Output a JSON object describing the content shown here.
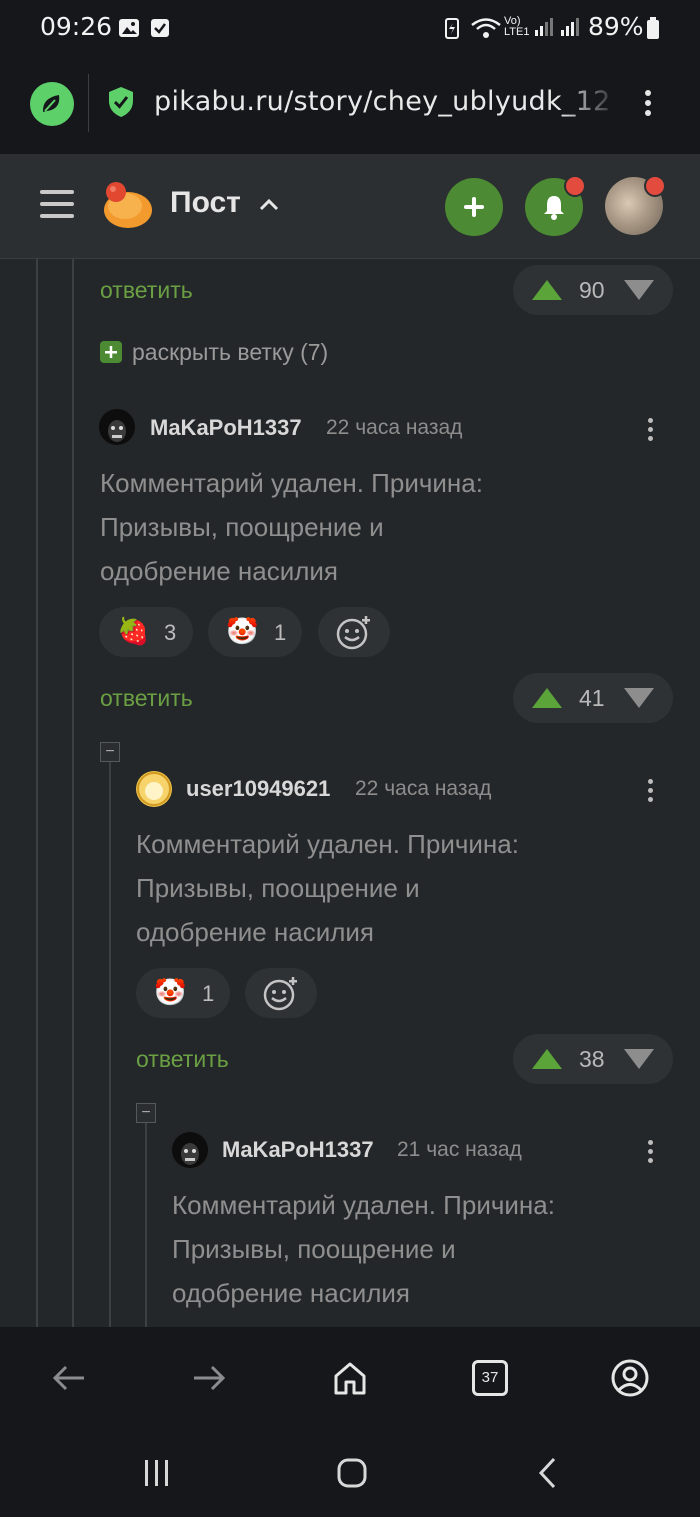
{
  "status_bar": {
    "time": "09:26",
    "battery": "89%"
  },
  "browser": {
    "url": "pikabu.ru/story/chey_ublyudk_12",
    "tab_count": "37"
  },
  "app_header": {
    "title": "Пост"
  },
  "comments": {
    "top_reply": {
      "reply_label": "ответить",
      "votes": "90"
    },
    "expand_branch": "раскрыть ветку (7)",
    "items": [
      {
        "username": "MaKaPoH1337",
        "time": "22 часа назад",
        "text_lines": [
          "Комментарий удален. Причина:",
          "Призывы, поощрение и",
          "одобрение насилия"
        ],
        "reactions": [
          {
            "emoji": "🍓",
            "count": "3"
          },
          {
            "emoji": "🤡",
            "count": "1"
          }
        ],
        "reply_label": "ответить",
        "votes": "41"
      },
      {
        "username": "user10949621",
        "time": "22 часа назад",
        "text_lines": [
          "Комментарий удален. Причина:",
          "Призывы, поощрение и",
          "одобрение насилия"
        ],
        "reactions": [
          {
            "emoji": "🤡",
            "count": "1"
          }
        ],
        "reply_label": "ответить",
        "votes": "38"
      },
      {
        "username": "MaKaPoH1337",
        "time": "21 час назад",
        "text_lines": [
          "Комментарий удален. Причина:",
          "Призывы, поощрение и",
          "одобрение насилия"
        ]
      }
    ]
  },
  "colors": {
    "accent_green": "#4c8b33",
    "reply_green": "#6aa043",
    "badge_red": "#e24b3d"
  }
}
